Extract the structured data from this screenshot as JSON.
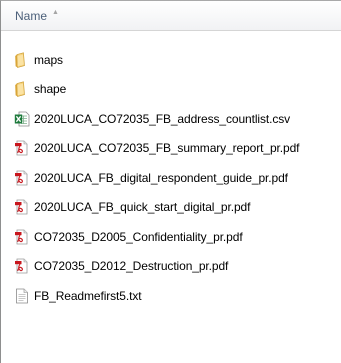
{
  "header": {
    "column_name": "Name"
  },
  "files": [
    {
      "name": "maps",
      "type": "folder",
      "icon": "folder-icon"
    },
    {
      "name": "shape",
      "type": "folder",
      "icon": "folder-icon"
    },
    {
      "name": "2020LUCA_CO72035_FB_address_countlist.csv",
      "type": "csv",
      "icon": "excel-csv-icon"
    },
    {
      "name": "2020LUCA_CO72035_FB_summary_report_pr.pdf",
      "type": "pdf",
      "icon": "pdf-icon"
    },
    {
      "name": "2020LUCA_FB_digital_respondent_guide_pr.pdf",
      "type": "pdf",
      "icon": "pdf-icon"
    },
    {
      "name": "2020LUCA_FB_quick_start_digital_pr.pdf",
      "type": "pdf",
      "icon": "pdf-icon"
    },
    {
      "name": "CO72035_D2005_Confidentiality_pr.pdf",
      "type": "pdf",
      "icon": "pdf-icon"
    },
    {
      "name": "CO72035_D2012_Destruction_pr.pdf",
      "type": "pdf",
      "icon": "pdf-icon"
    },
    {
      "name": "FB_Readmefirst5.txt",
      "type": "txt",
      "icon": "text-file-icon"
    }
  ],
  "colors": {
    "header_text": "#4c607a",
    "folder": "#e8b94a",
    "pdf": "#c8161d",
    "excel": "#1d7a3c"
  }
}
